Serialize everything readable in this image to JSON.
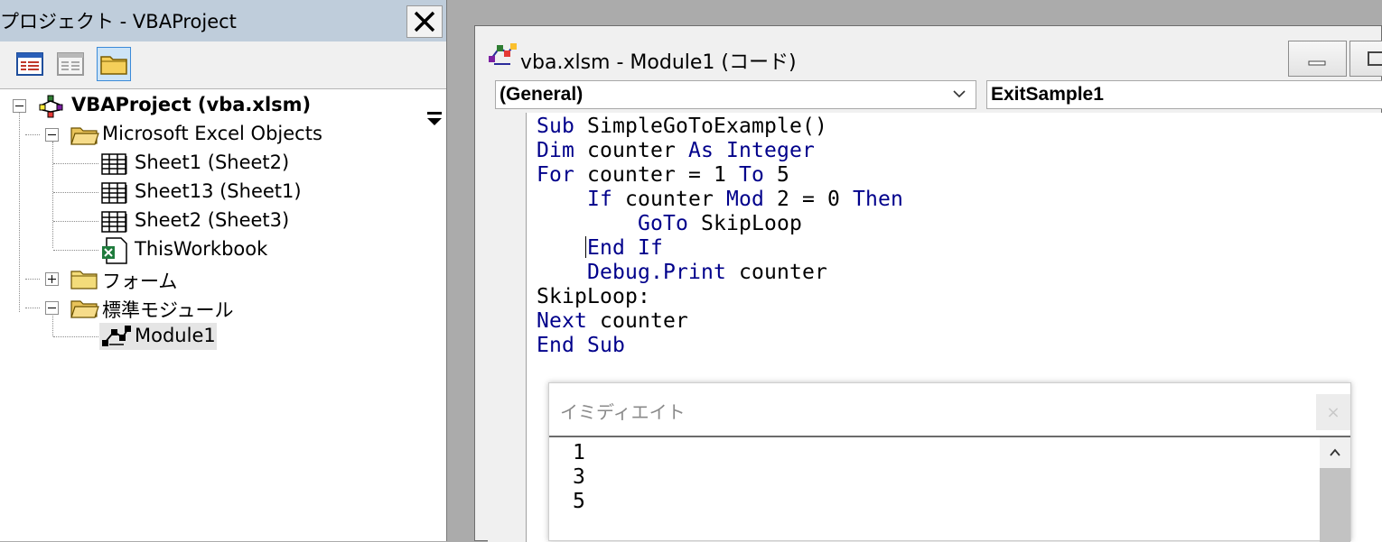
{
  "project": {
    "title": "プロジェクト - VBAProject",
    "toolbar": {
      "view_code_icon": "view-code-icon",
      "view_object_icon": "view-object-icon",
      "toggle_folders_icon": "folder-icon"
    },
    "tree": {
      "root": "VBAProject (vba.xlsm)",
      "excel_objects": "Microsoft Excel Objects",
      "sheets": [
        "Sheet1 (Sheet2)",
        "Sheet13 (Sheet1)",
        "Sheet2 (Sheet3)"
      ],
      "workbook": "ThisWorkbook",
      "forms": "フォーム",
      "modules_folder": "標準モジュール",
      "module": "Module1"
    }
  },
  "code_window": {
    "title": "vba.xlsm - Module1 (コード)",
    "object_combo": "(General)",
    "procedure_combo": "ExitSample1",
    "lines": [
      [
        {
          "t": "Sub",
          "k": 1
        },
        {
          "t": " SimpleGoToExample()",
          "k": 0
        }
      ],
      [
        {
          "t": "Dim",
          "k": 1
        },
        {
          "t": " counter ",
          "k": 0
        },
        {
          "t": "As Integer",
          "k": 1
        }
      ],
      [
        {
          "t": "For",
          "k": 1
        },
        {
          "t": " counter = 1 ",
          "k": 0
        },
        {
          "t": "To",
          "k": 1
        },
        {
          "t": " 5",
          "k": 0
        }
      ],
      [
        {
          "t": "    ",
          "k": 0
        },
        {
          "t": "If",
          "k": 1
        },
        {
          "t": " counter ",
          "k": 0
        },
        {
          "t": "Mod",
          "k": 1
        },
        {
          "t": " 2 = 0 ",
          "k": 0
        },
        {
          "t": "Then",
          "k": 1
        }
      ],
      [
        {
          "t": "        ",
          "k": 0
        },
        {
          "t": "GoTo",
          "k": 1
        },
        {
          "t": " SkipLoop",
          "k": 0
        }
      ],
      [
        {
          "t": "    ",
          "k": 0
        },
        {
          "t": "End If",
          "k": 1
        }
      ],
      [
        {
          "t": "    ",
          "k": 0
        },
        {
          "t": "Debug.Print",
          "k": 1
        },
        {
          "t": " counter",
          "k": 0
        }
      ],
      [
        {
          "t": "SkipLoop:",
          "k": 0
        }
      ],
      [
        {
          "t": "Next",
          "k": 1
        },
        {
          "t": " counter",
          "k": 0
        }
      ],
      [
        {
          "t": "End Sub",
          "k": 1
        }
      ]
    ]
  },
  "immediate": {
    "title": "イミディエイト",
    "close": "×",
    "output": [
      "1",
      "3",
      "5"
    ]
  },
  "colors": {
    "keyword": "#00008b",
    "titlebar": "#bfcddb",
    "selected_button": "#cde4f7"
  }
}
